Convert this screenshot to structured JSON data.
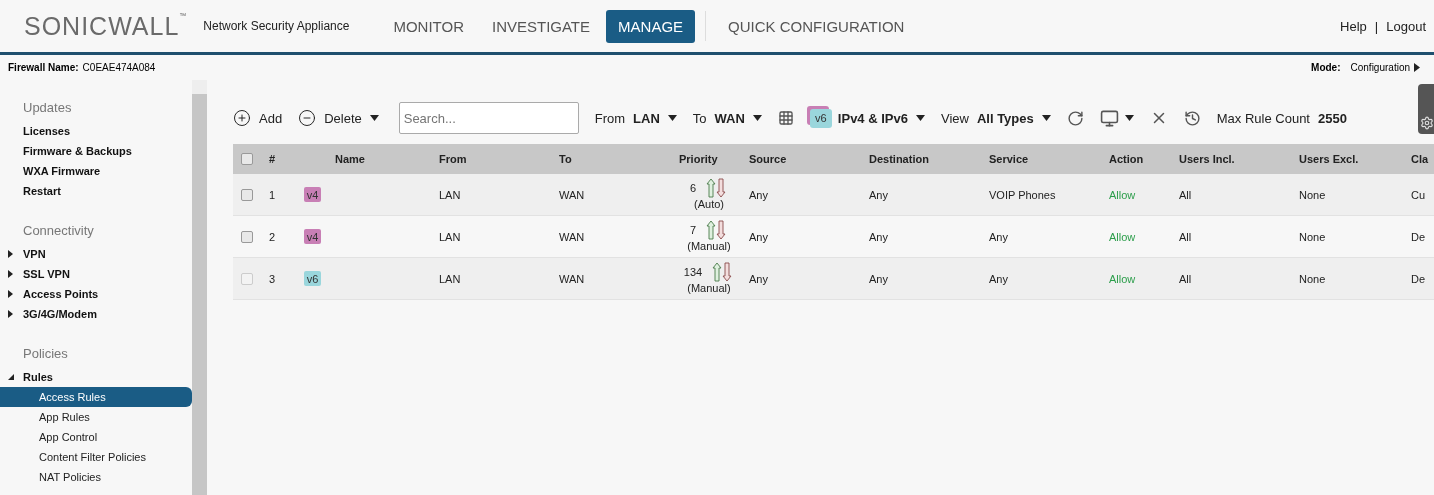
{
  "header": {
    "brand": "SONICWALL",
    "brand_mark": "™",
    "product": "Network Security Appliance",
    "nav": [
      {
        "label": "MONITOR",
        "selected": false
      },
      {
        "label": "INVESTIGATE",
        "selected": false
      },
      {
        "label": "MANAGE",
        "selected": true
      },
      {
        "label": "QUICK CONFIGURATION",
        "selected": false
      }
    ],
    "links": [
      "Help",
      "Logout"
    ],
    "link_separator": "|"
  },
  "info_bar": {
    "firewall_label": "Firewall Name:",
    "firewall_value": "C0EAE474A084",
    "mode_label": "Mode:",
    "mode_value": "Configuration"
  },
  "sidebar": [
    {
      "heading": "Updates",
      "items": [
        {
          "label": "Licenses"
        },
        {
          "label": "Firmware & Backups"
        },
        {
          "label": "WXA Firmware"
        },
        {
          "label": "Restart"
        }
      ]
    },
    {
      "heading": "Connectivity",
      "items": [
        {
          "label": "VPN",
          "expanded": false
        },
        {
          "label": "SSL VPN",
          "expanded": false
        },
        {
          "label": "Access Points",
          "expanded": false
        },
        {
          "label": "3G/4G/Modem",
          "expanded": false
        }
      ]
    },
    {
      "heading": "Policies",
      "items": [
        {
          "label": "Rules",
          "expanded": true,
          "children": [
            {
              "label": "Access Rules",
              "selected": true
            },
            {
              "label": "App Rules",
              "selected": false
            },
            {
              "label": "App Control",
              "selected": false
            },
            {
              "label": "Content Filter Policies",
              "selected": false
            },
            {
              "label": "NAT Policies",
              "selected": false
            }
          ]
        }
      ]
    }
  ],
  "toolbar": {
    "add": "Add",
    "delete": "Delete",
    "search": {
      "placeholder": "Search..."
    },
    "from_label": "From",
    "from_value": "LAN",
    "to_label": "To",
    "to_value": "WAN",
    "ip_badge": "v6",
    "ip_value": "IPv4 & IPv6",
    "view_label": "View",
    "view_value": "All Types",
    "max_label": "Max Rule Count",
    "max_value": "2550"
  },
  "table": {
    "select_all_checked": false,
    "columns": [
      "#",
      "Name",
      "From",
      "To",
      "Priority",
      "Source",
      "Destination",
      "Service",
      "Action",
      "Users Incl.",
      "Users Excl.",
      "Cla"
    ],
    "rows": [
      {
        "checked": false,
        "disabled": false,
        "number": "1",
        "tag": {
          "label": "v4",
          "color": "#c87fb5"
        },
        "from": "LAN",
        "to": "WAN",
        "priority": "6",
        "priority_mode": "(Auto)",
        "source": "Any",
        "destination": "Any",
        "service": "VOIP Phones",
        "action": "Allow",
        "users_incl": "All",
        "users_excl": "None",
        "column_12": "Cu"
      },
      {
        "checked": false,
        "disabled": false,
        "number": "2",
        "tag": {
          "label": "v4",
          "color": "#c87fb5"
        },
        "from": "LAN",
        "to": "WAN",
        "priority": "7",
        "priority_mode": "(Manual)",
        "source": "Any",
        "destination": "Any",
        "service": "Any",
        "action": "Allow",
        "users_incl": "All",
        "users_excl": "None",
        "column_12": "De"
      },
      {
        "checked": false,
        "disabled": true,
        "number": "3",
        "tag": {
          "label": "v6",
          "color": "#9ad6dc"
        },
        "from": "LAN",
        "to": "WAN",
        "priority": "134",
        "priority_mode": "(Manual)",
        "source": "Any",
        "destination": "Any",
        "service": "Any",
        "action": "Allow",
        "users_incl": "All",
        "users_excl": "None",
        "column_12": "De"
      }
    ]
  }
}
